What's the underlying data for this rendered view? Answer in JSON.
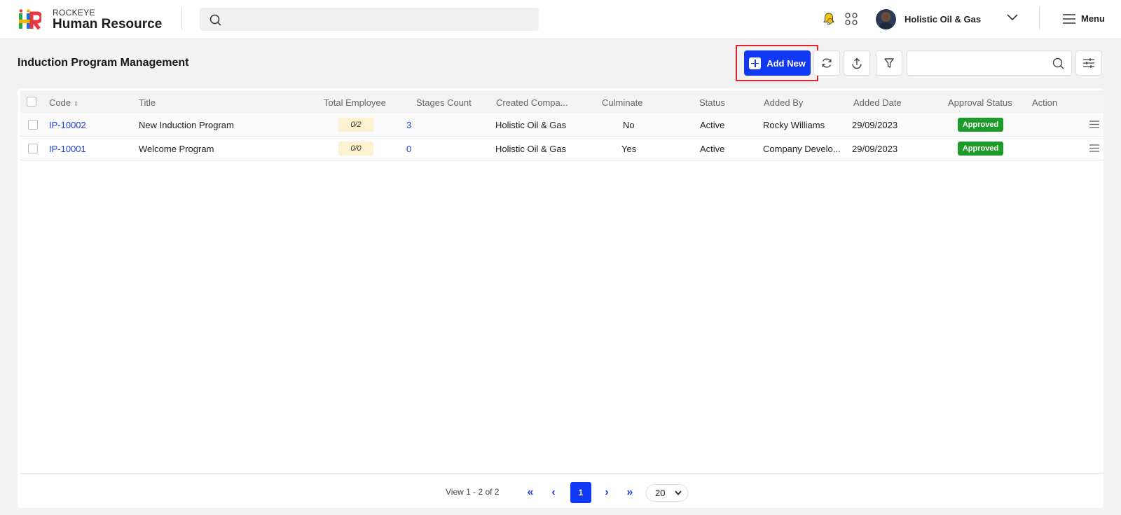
{
  "header": {
    "brand_top": "ROCKEYE",
    "brand_main": "Human Resource",
    "search_placeholder": "",
    "company_name": "Holistic Oil & Gas",
    "menu_label": "Menu"
  },
  "page": {
    "title": "Induction Program Management",
    "add_new_label": "Add New",
    "table_search_placeholder": ""
  },
  "table": {
    "columns": [
      "Code",
      "Title",
      "Total Employee",
      "Stages Count",
      "Created Compa...",
      "Culminate",
      "Status",
      "Added By",
      "Added Date",
      "Approval Status",
      "Action"
    ],
    "rows": [
      {
        "code": "IP-10002",
        "title": "New Induction Program",
        "total_employee": "0/2",
        "stages_count": "3",
        "company": "Holistic Oil & Gas",
        "culminate": "No",
        "status": "Active",
        "added_by": "Rocky Williams",
        "added_date": "29/09/2023",
        "approval": "Approved"
      },
      {
        "code": "IP-10001",
        "title": "Welcome Program",
        "total_employee": "0/0",
        "stages_count": "0",
        "company": "Holistic Oil & Gas",
        "culminate": "Yes",
        "status": "Active",
        "added_by": "Company Develo...",
        "added_date": "29/09/2023",
        "approval": "Approved"
      }
    ]
  },
  "pagination": {
    "view_text": "View 1 - 2 of 2",
    "current_page": "1",
    "page_size": "20"
  },
  "colors": {
    "primary": "#1138f5",
    "approved": "#1d9b2a",
    "highlight_border": "#e0242a",
    "pill_bg": "#fdf2cf"
  }
}
